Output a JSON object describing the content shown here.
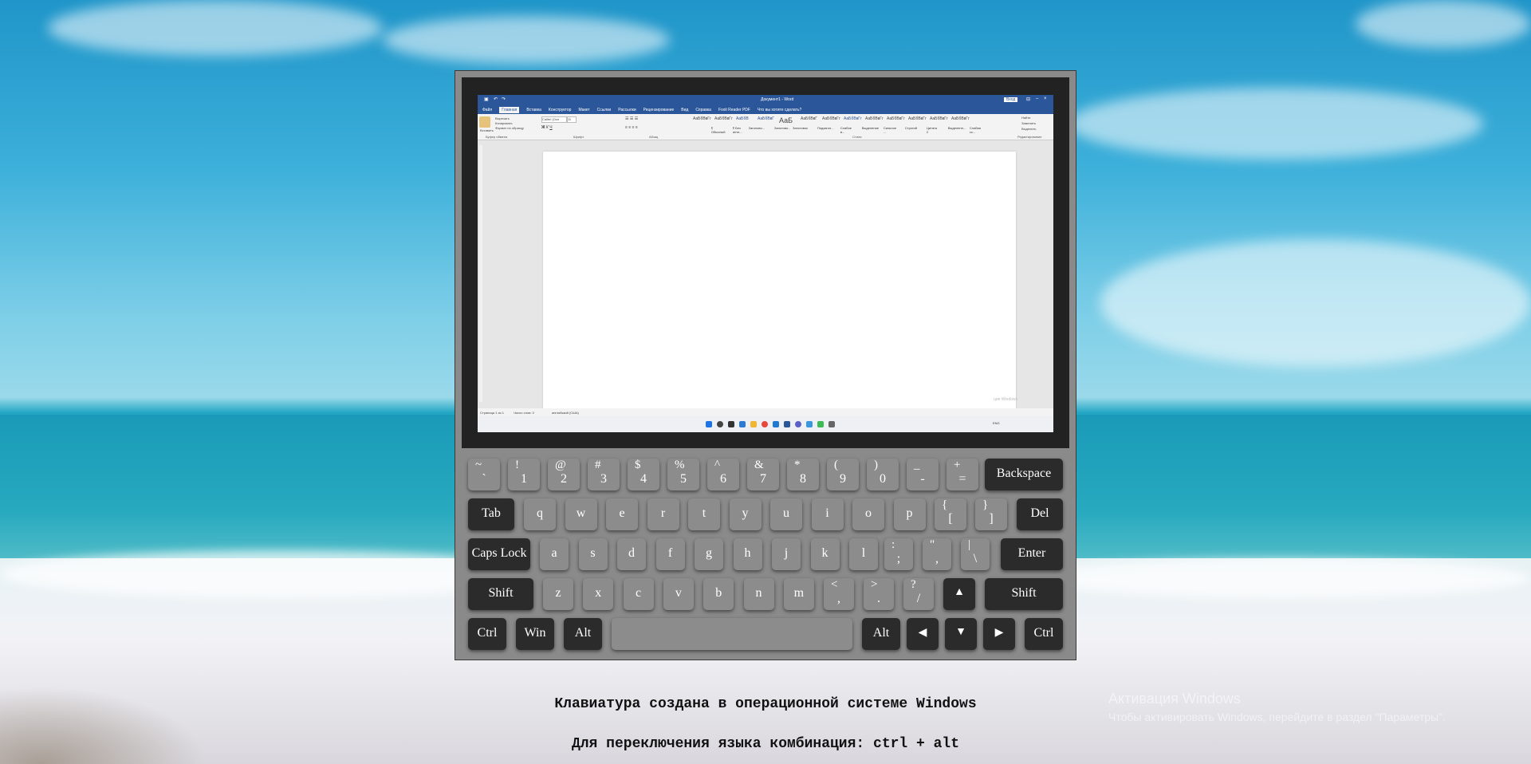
{
  "word": {
    "doc_title": "Документ1 - Word",
    "signin": "Вход",
    "tabs": [
      "Файл",
      "Главная",
      "Вставка",
      "Конструктор",
      "Макет",
      "Ссылки",
      "Рассылки",
      "Рецензирование",
      "Вид",
      "Справка",
      "Foxit Reader PDF",
      "Что вы хотите сделать?"
    ],
    "active_tab_index": 1,
    "font_name": "Calibri (Осн",
    "font_size": "11",
    "styles": [
      "АаБбВвГг",
      "АаБбВвГг",
      "АаБбВ",
      "АаБбВвГ",
      "АаБ",
      "АаБбВвГ",
      "АаБбВвГг",
      "АаБбВвГг",
      "АаБбВвГг",
      "АаБбВвГг",
      "АаБбВвГг",
      "АаБбВвГг",
      "АаБбВвГг"
    ],
    "style_labels": [
      "¶ Обычный",
      "¶ Без инте...",
      "Заголово...",
      "Заголово...",
      "Заголовок",
      "Подзагол...",
      "Слабое в...",
      "Выделение",
      "Сильное ...",
      "Строгий",
      "Цитата 2",
      "Выделенн...",
      "Слабая сс..."
    ],
    "groups": [
      "Буфер обмена",
      "Шрифт",
      "Абзац",
      "Стили",
      "Редактирование"
    ],
    "edit_actions": [
      "Найти",
      "Заменить",
      "Выделить"
    ],
    "clipboard_actions": [
      "Вставить",
      "Вырезать",
      "Копировать",
      "Формат по образцу"
    ],
    "status_page": "Страница 1 из 1",
    "status_words": "Число слов: 0",
    "status_lang": "английский (США)",
    "watermark_small": "ция Windows",
    "tray_lang": "ENG"
  },
  "keyboard": {
    "row1": [
      {
        "top": "~",
        "bottom": "`"
      },
      {
        "top": "!",
        "bottom": "1"
      },
      {
        "top": "@",
        "bottom": "2"
      },
      {
        "top": "#",
        "bottom": "3"
      },
      {
        "top": "$",
        "bottom": "4"
      },
      {
        "top": "%",
        "bottom": "5"
      },
      {
        "top": "^",
        "bottom": "6"
      },
      {
        "top": "&",
        "bottom": "7"
      },
      {
        "top": "*",
        "bottom": "8"
      },
      {
        "top": "(",
        "bottom": "9"
      },
      {
        "top": ")",
        "bottom": "0"
      },
      {
        "top": "_",
        "bottom": "-"
      },
      {
        "top": "+",
        "bottom": "="
      }
    ],
    "backspace": "Backspace",
    "tab": "Tab",
    "row2": [
      "q",
      "w",
      "e",
      "r",
      "t",
      "y",
      "u",
      "i",
      "o",
      "p"
    ],
    "row2_sym": [
      {
        "top": "{",
        "bottom": "["
      },
      {
        "top": "}",
        "bottom": "]"
      }
    ],
    "del": "Del",
    "capslock": "Caps Lock",
    "row3": [
      "a",
      "s",
      "d",
      "f",
      "g",
      "h",
      "j",
      "k",
      "l"
    ],
    "row3_sym": [
      {
        "top": ":",
        "bottom": ";"
      },
      {
        "top": "\"",
        "bottom": ","
      },
      {
        "top": "|",
        "bottom": "\\"
      }
    ],
    "enter": "Enter",
    "shift": "Shift",
    "row4": [
      "z",
      "x",
      "c",
      "v",
      "b",
      "n",
      "m"
    ],
    "row4_sym": [
      {
        "top": "<",
        "bottom": ","
      },
      {
        "top": ">",
        "bottom": "."
      },
      {
        "top": "?",
        "bottom": "/"
      }
    ],
    "arrow_up": "▲",
    "arrow_left": "◀",
    "arrow_down": "▼",
    "arrow_right": "▶",
    "ctrl": "Ctrl",
    "win": "Win",
    "alt": "Alt"
  },
  "captions": {
    "line1": "Клавиатура создана в операционной системе Windows",
    "line2": "Для переключения языка комбинация: ctrl + alt"
  },
  "activation": {
    "title": "Активация Windows",
    "subtitle": "Чтобы активировать Windows, перейдите в раздел \"Параметры\"."
  }
}
